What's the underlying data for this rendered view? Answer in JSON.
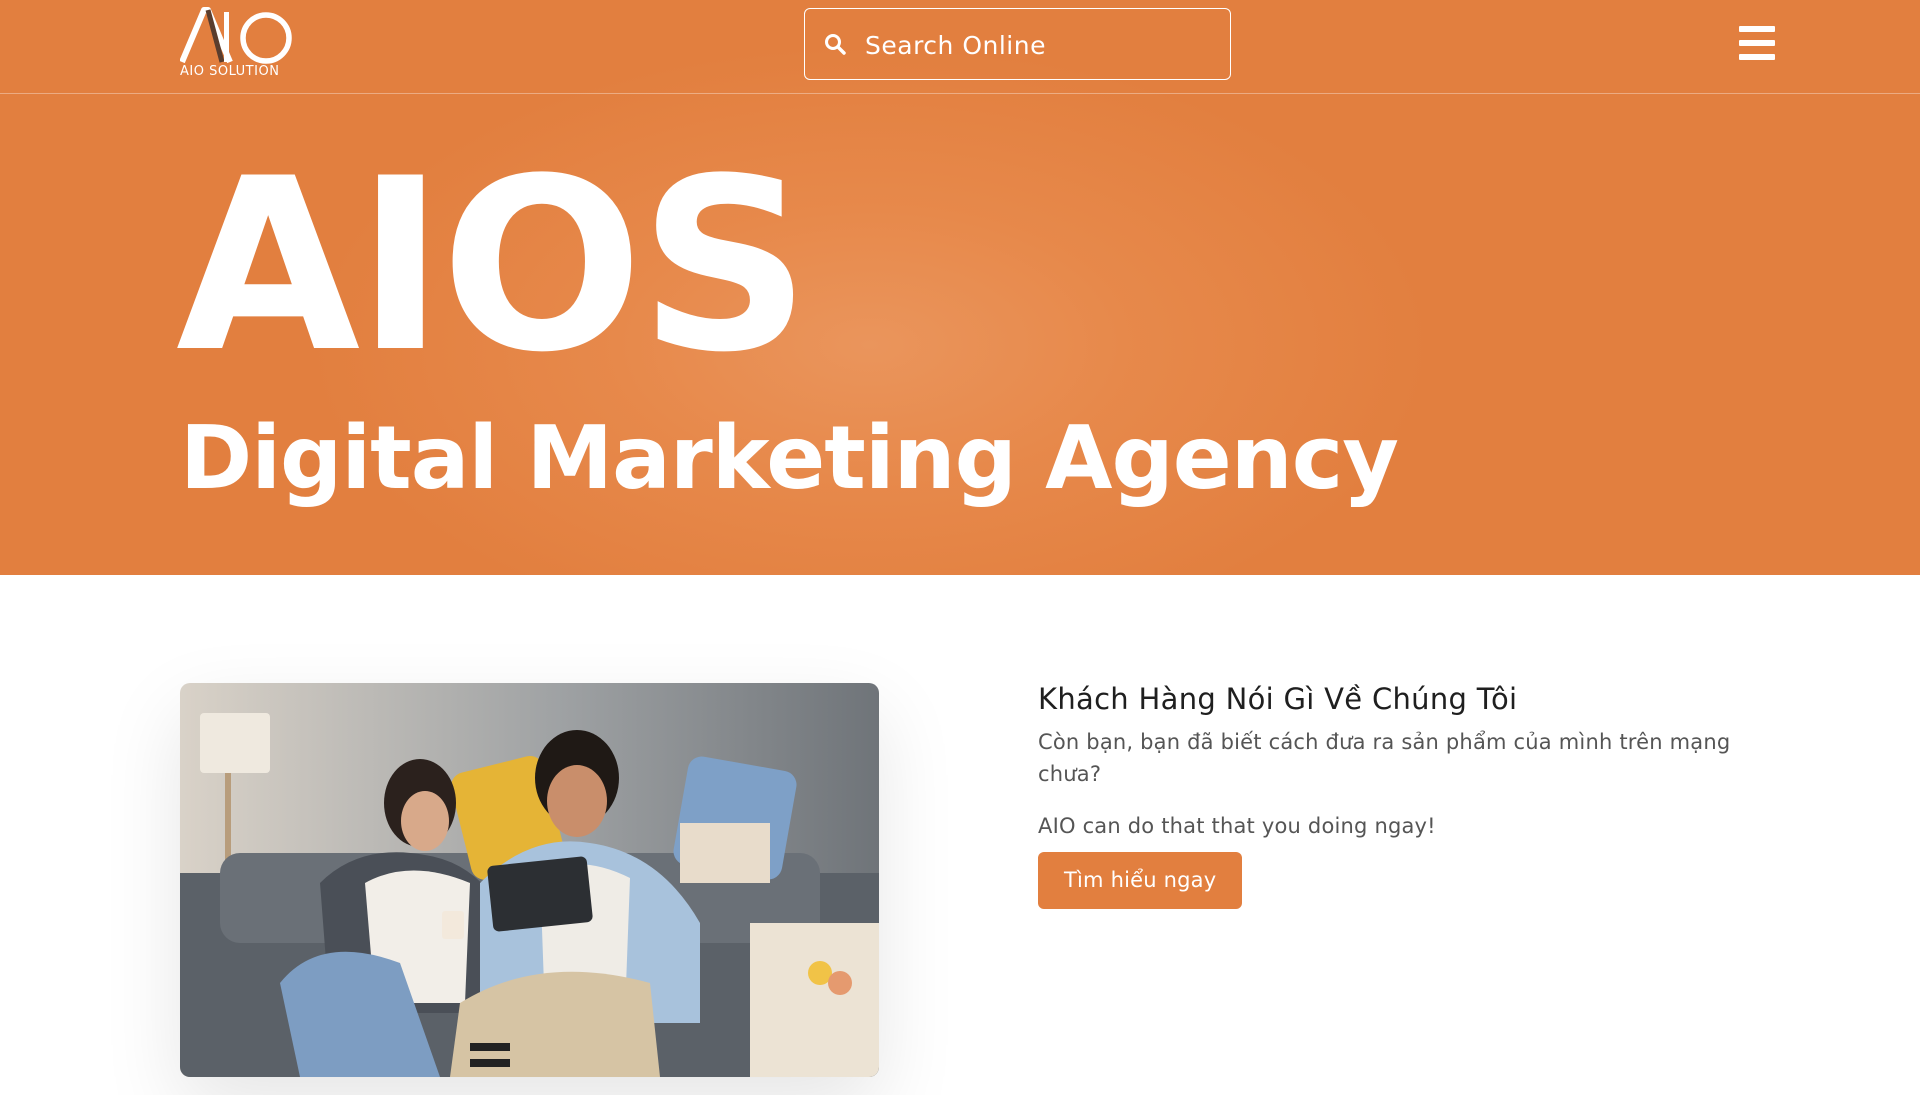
{
  "colors": {
    "brand_orange": "#e27f3f",
    "text_dark": "#1f1f1f",
    "text_muted": "#555555",
    "white": "#ffffff"
  },
  "header": {
    "logo_mark": "AIO",
    "logo_caption": "AIO SOLUTION",
    "search": {
      "icon": "search-icon",
      "placeholder": "Search Online"
    },
    "menu_icon": "hamburger-menu-icon"
  },
  "hero": {
    "title": "AIOS",
    "subtitle": "Digital Marketing Agency"
  },
  "testimonial": {
    "heading": "Khách Hàng Nói Gì Về Chúng Tôi",
    "description": "Còn bạn, bạn đã biết cách đưa ra sản phẩm của mình trên mạng chưa?",
    "tagline": "AIO can do that that you doing ngay!",
    "button_label": "Tìm hiểu ngay",
    "image": "couple-on-sofa-with-tablet-photo"
  }
}
